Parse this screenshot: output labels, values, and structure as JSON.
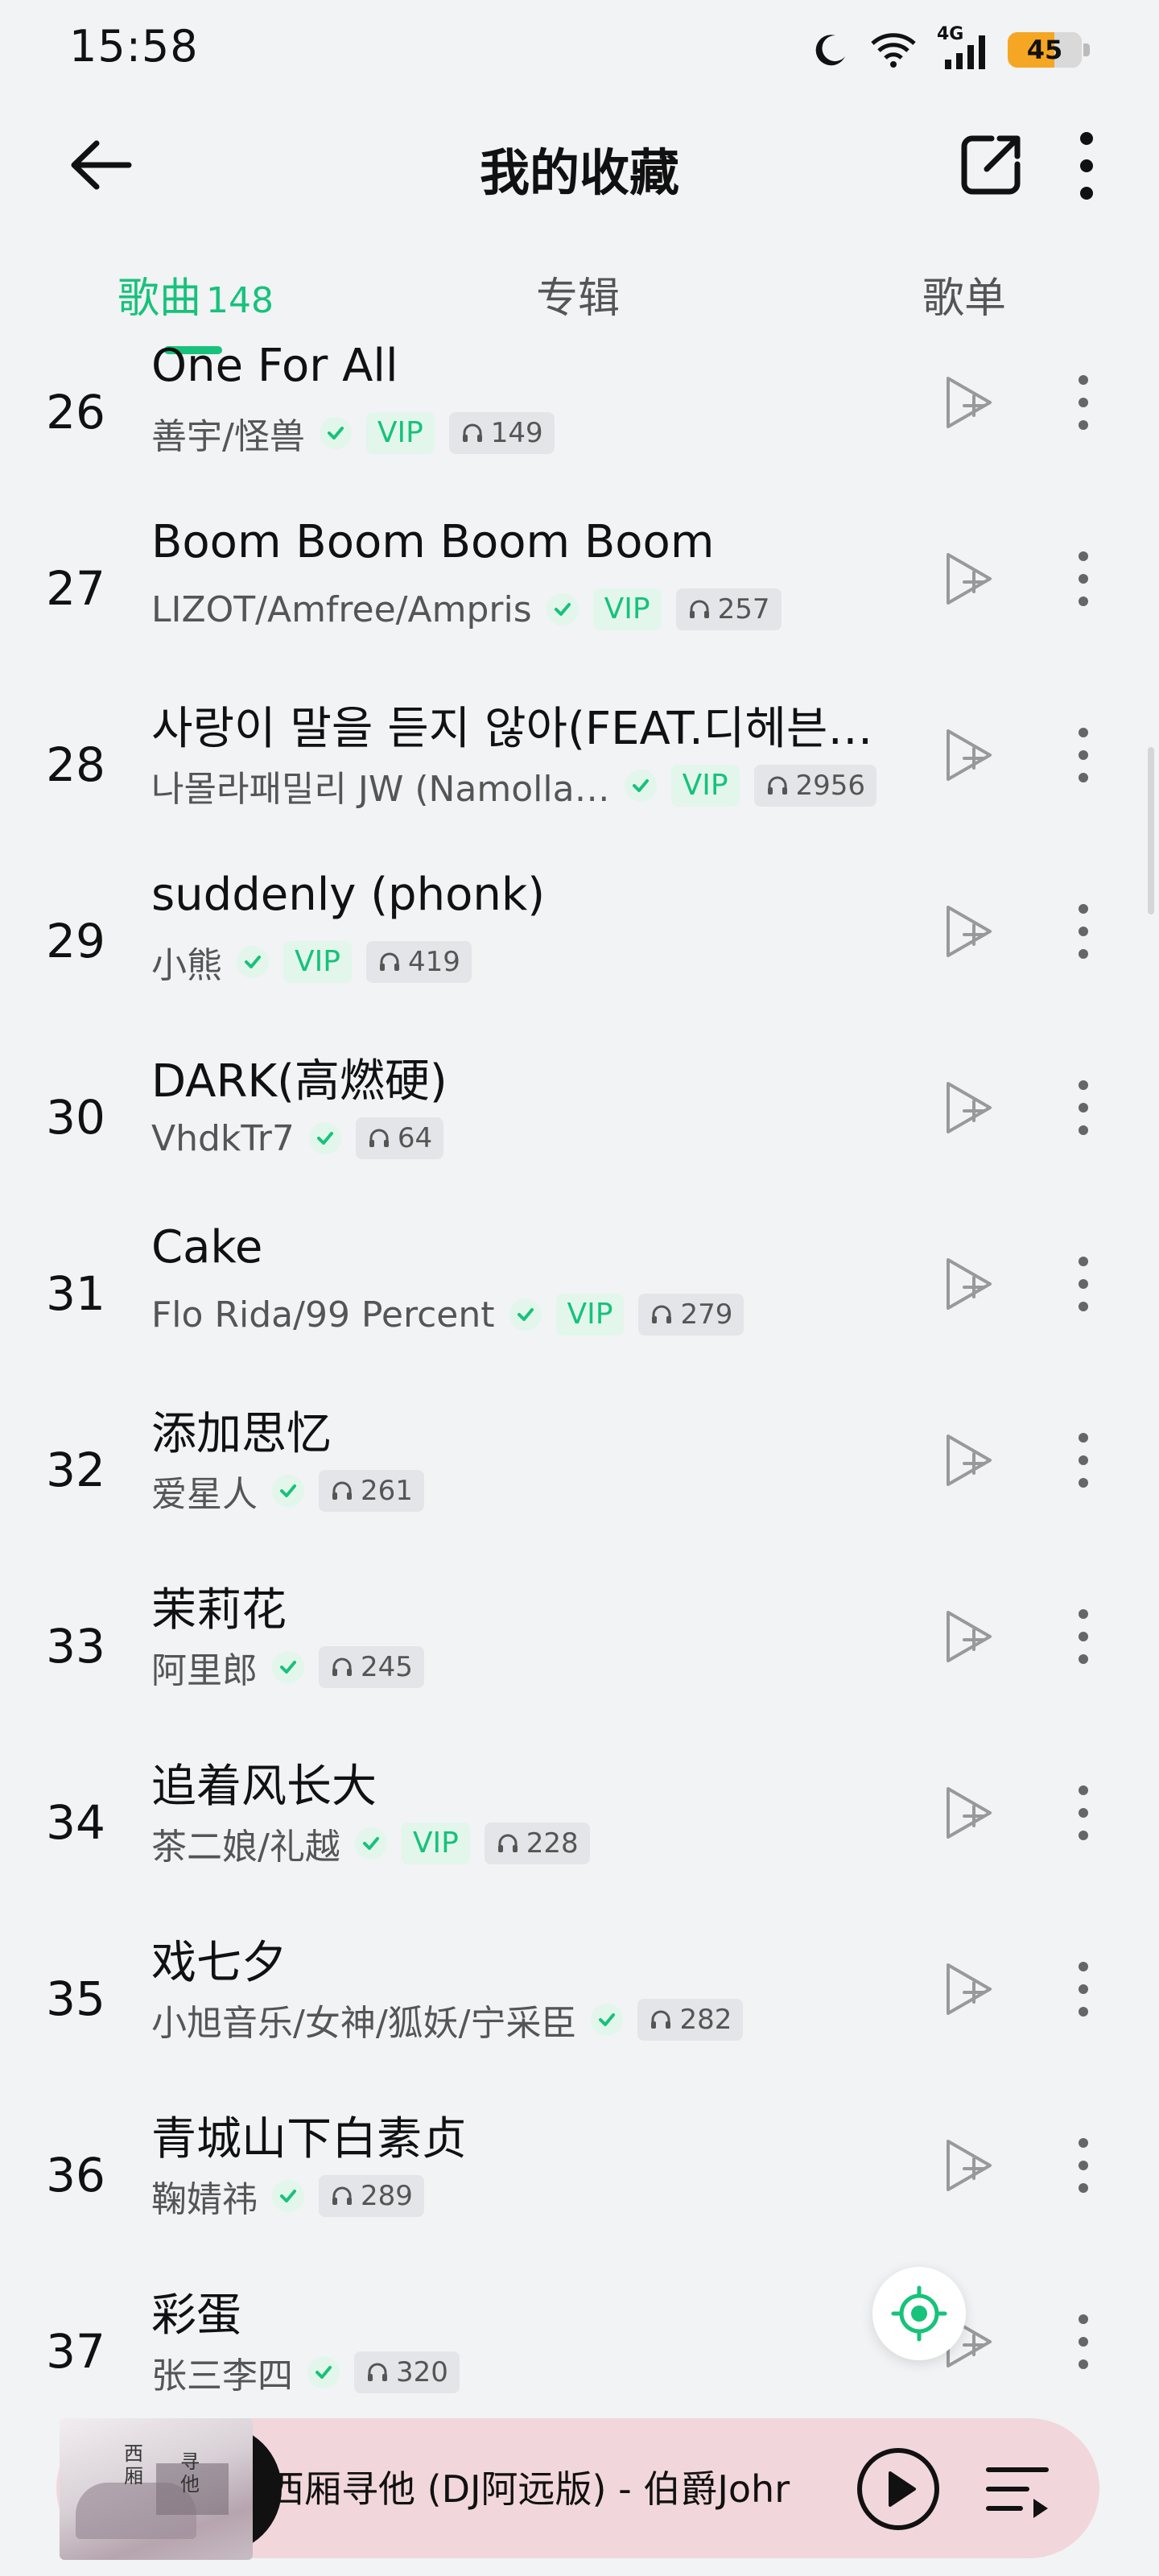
{
  "status_bar": {
    "time": "15:58",
    "network": "4G",
    "battery": "45"
  },
  "header": {
    "title": "我的收藏"
  },
  "tabs": [
    {
      "label": "歌曲",
      "count": "148"
    },
    {
      "label": "专辑"
    },
    {
      "label": "歌单"
    }
  ],
  "songs": [
    {
      "index": "26",
      "title": "One For All",
      "artist": "善宇/怪兽",
      "vip": "VIP",
      "plays": "149"
    },
    {
      "index": "27",
      "title": "Boom Boom Boom Boom",
      "artist": "LIZOT/Amfree/Ampris",
      "vip": "VIP",
      "plays": "257"
    },
    {
      "index": "28",
      "title": "사랑이 말을 듣지 않아(FEAT.디헤븐…",
      "artist": "나몰라패밀리 JW (Namolla…",
      "vip": "VIP",
      "plays": "2956"
    },
    {
      "index": "29",
      "title": "suddenly (phonk)",
      "artist": "小熊",
      "vip": "VIP",
      "plays": "419"
    },
    {
      "index": "30",
      "title": "DARK(高燃硬)",
      "artist": "VhdkTr7",
      "vip": "",
      "plays": "64"
    },
    {
      "index": "31",
      "title": "Cake",
      "artist": "Flo Rida/99 Percent",
      "vip": "VIP",
      "plays": "279"
    },
    {
      "index": "32",
      "title": "添加思忆",
      "artist": "爱星人",
      "vip": "",
      "plays": "261"
    },
    {
      "index": "33",
      "title": "茉莉花",
      "artist": "阿里郎",
      "vip": "",
      "plays": "245"
    },
    {
      "index": "34",
      "title": "追着风长大",
      "artist": "茶二娘/礼越",
      "vip": "VIP",
      "plays": "228"
    },
    {
      "index": "35",
      "title": "戏七夕",
      "artist": "小旭音乐/女神/狐妖/宁采臣",
      "vip": "",
      "plays": "282"
    },
    {
      "index": "36",
      "title": "青城山下白素贞",
      "artist": "鞠婧祎",
      "vip": "",
      "plays": "289"
    },
    {
      "index": "37",
      "title": "彩蛋",
      "artist": "张三李四",
      "vip": "",
      "plays": "320"
    }
  ],
  "player": {
    "now_playing": "西厢寻他 (DJ阿远版) - 伯爵Johr",
    "album_art_text": [
      "西",
      "厢",
      "寻",
      "他"
    ]
  },
  "colors": {
    "accent": "#17c27a",
    "background": "#f1f3f5",
    "player_bg": "#f1d7db",
    "battery": "#f5a623"
  },
  "icons": {
    "back": "arrow-left-icon",
    "share": "share-icon",
    "more": "more-vertical-icon",
    "verified": "check-icon",
    "plays": "headphones-icon",
    "add_next": "play-next-icon",
    "locate": "locate-icon",
    "play": "play-icon",
    "playlist": "playlist-icon"
  }
}
